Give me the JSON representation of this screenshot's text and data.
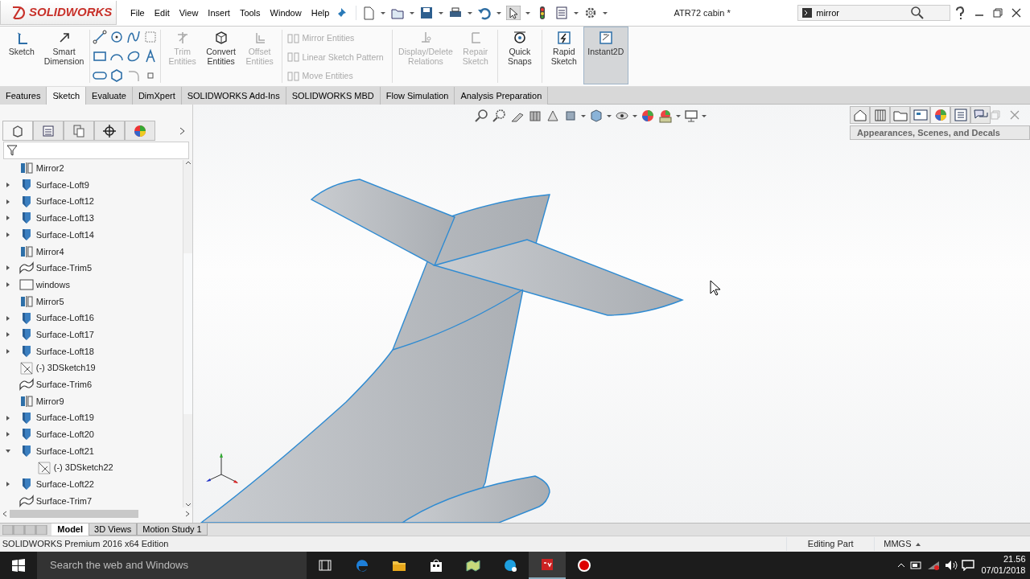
{
  "app": {
    "logo": "SOLIDWORKS"
  },
  "menu": [
    "File",
    "Edit",
    "View",
    "Insert",
    "Tools",
    "Window",
    "Help"
  ],
  "document_title": "ATR72 cabin *",
  "search": {
    "value": "mirror"
  },
  "command_manager": [
    {
      "kind": "large",
      "label": "Sketch",
      "disabled": false,
      "pressed": false
    },
    {
      "kind": "large",
      "label": "Smart Dimension",
      "disabled": false,
      "pressed": false
    },
    {
      "kind": "icon_grid"
    },
    {
      "kind": "large",
      "label": "Trim Entities",
      "disabled": true,
      "pressed": false
    },
    {
      "kind": "large",
      "label": "Convert Entities",
      "disabled": false,
      "pressed": false
    },
    {
      "kind": "large",
      "label": "Offset Entities",
      "disabled": true,
      "pressed": false
    },
    {
      "kind": "small_group",
      "items": [
        {
          "label": "Mirror Entities",
          "disabled": true
        },
        {
          "label": "Linear Sketch Pattern",
          "disabled": true
        },
        {
          "label": "Move Entities",
          "disabled": true
        }
      ]
    },
    {
      "kind": "large",
      "label": "Display/Delete Relations",
      "disabled": true,
      "pressed": false
    },
    {
      "kind": "large",
      "label": "Repair Sketch",
      "disabled": true,
      "pressed": false
    },
    {
      "kind": "large",
      "label": "Quick Snaps",
      "disabled": false,
      "pressed": false
    },
    {
      "kind": "large",
      "label": "Rapid Sketch",
      "disabled": false,
      "pressed": false
    },
    {
      "kind": "large",
      "label": "Instant2D",
      "disabled": false,
      "pressed": true
    }
  ],
  "tabs": [
    {
      "label": "Features",
      "selected": false
    },
    {
      "label": "Sketch",
      "selected": true
    },
    {
      "label": "Evaluate",
      "selected": false
    },
    {
      "label": "DimXpert",
      "selected": false
    },
    {
      "label": "SOLIDWORKS Add-Ins",
      "selected": false
    },
    {
      "label": "SOLIDWORKS MBD",
      "selected": false
    },
    {
      "label": "Flow Simulation",
      "selected": false
    },
    {
      "label": "Analysis Preparation",
      "selected": false
    }
  ],
  "task_pane": {
    "title": "Appearances, Scenes, and Decals"
  },
  "feature_tree": [
    {
      "label": "Mirror2",
      "kind": "mirror"
    },
    {
      "label": "Surface-Loft9",
      "kind": "loft",
      "expanded": false
    },
    {
      "label": "Surface-Loft12",
      "kind": "loft",
      "expanded": false
    },
    {
      "label": "Surface-Loft13",
      "kind": "loft",
      "expanded": false
    },
    {
      "label": "Surface-Loft14",
      "kind": "loft",
      "expanded": false
    },
    {
      "label": "Mirror4",
      "kind": "mirror"
    },
    {
      "label": "Surface-Trim5",
      "kind": "trim",
      "expanded": false
    },
    {
      "label": "windows",
      "kind": "folder",
      "expanded": false
    },
    {
      "label": "Mirror5",
      "kind": "mirror"
    },
    {
      "label": "Surface-Loft16",
      "kind": "loft",
      "expanded": false
    },
    {
      "label": "Surface-Loft17",
      "kind": "loft",
      "expanded": false
    },
    {
      "label": "Surface-Loft18",
      "kind": "loft",
      "expanded": false
    },
    {
      "label": "(-) 3DSketch19",
      "kind": "sketch3d"
    },
    {
      "label": "Surface-Trim6",
      "kind": "trim"
    },
    {
      "label": "Mirror9",
      "kind": "mirror"
    },
    {
      "label": "Surface-Loft19",
      "kind": "loft",
      "expanded": false
    },
    {
      "label": "Surface-Loft20",
      "kind": "loft",
      "expanded": false
    },
    {
      "label": "Surface-Loft21",
      "kind": "loft",
      "expanded": true,
      "children": [
        {
          "label": "(-) 3DSketch22",
          "kind": "sketch3d"
        }
      ]
    },
    {
      "label": "Surface-Loft22",
      "kind": "loft",
      "expanded": false
    },
    {
      "label": "Surface-Trim7",
      "kind": "trim"
    }
  ],
  "bottom_tabs": [
    {
      "label": "Model",
      "selected": true
    },
    {
      "label": "3D Views",
      "selected": false
    },
    {
      "label": "Motion Study 1",
      "selected": false
    }
  ],
  "status_bar": {
    "edition": "SOLIDWORKS Premium 2016 x64 Edition",
    "mode": "Editing Part",
    "units": "MMGS"
  },
  "taskbar": {
    "search_placeholder": "Search the web and Windows",
    "time": "21.56",
    "date": "07/01/2018"
  }
}
